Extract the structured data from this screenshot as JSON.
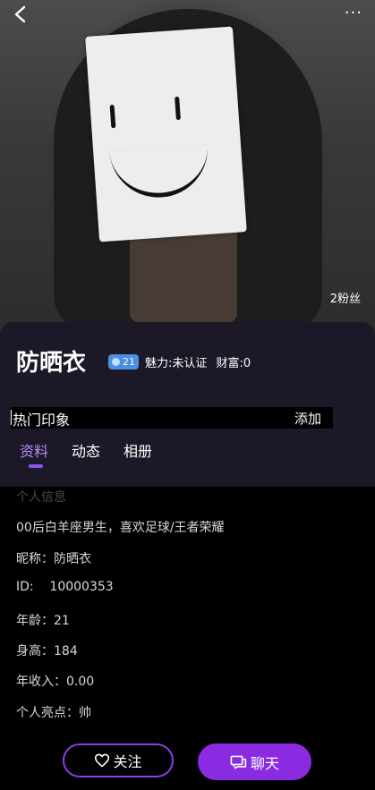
{
  "header": {
    "more_label": "···"
  },
  "profile": {
    "fans": "2粉丝",
    "name": "防晒衣",
    "level": "21",
    "charm": "魅力:未认证",
    "wealth": "财富:0"
  },
  "impression": {
    "label": "热门印象",
    "add_label": "添加"
  },
  "tabs": [
    {
      "label": "资料",
      "active": true
    },
    {
      "label": "动态",
      "active": false
    },
    {
      "label": "相册",
      "active": false
    }
  ],
  "info": {
    "section_title": "个人信息",
    "bio": "00后白羊座男生，喜欢足球/王者荣耀",
    "nickname": "昵称：防晒衣",
    "id": "ID:    10000353",
    "age": "年龄：21",
    "height": "身高：184",
    "income": "年收入：0.00",
    "highlight": "个人亮点：帅"
  },
  "actions": {
    "follow_label": "关注",
    "chat_label": "聊天"
  },
  "colors": {
    "accent": "#8a2be2",
    "panel": "#1d1827",
    "tab_active": "#b68cf5",
    "level_badge": "#4a8fe0"
  }
}
